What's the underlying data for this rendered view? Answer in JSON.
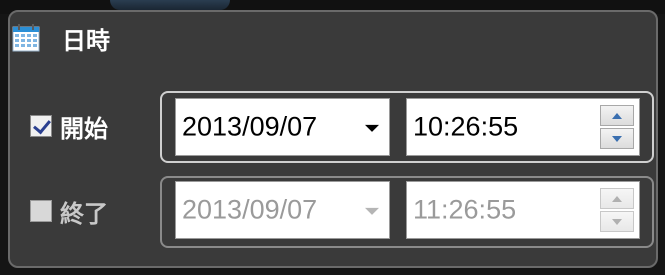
{
  "section": {
    "title": "日時",
    "icon": "calendar-icon"
  },
  "start": {
    "label": "開始",
    "checked": true,
    "date": "2013/09/07",
    "time": "10:26:55",
    "enabled": true
  },
  "end": {
    "label": "終了",
    "checked": false,
    "date": "2013/09/07",
    "time": "11:26:55",
    "enabled": false
  },
  "colors": {
    "panel_background": "#3a3a3a",
    "calendar_accent": "#2b8fd6"
  }
}
